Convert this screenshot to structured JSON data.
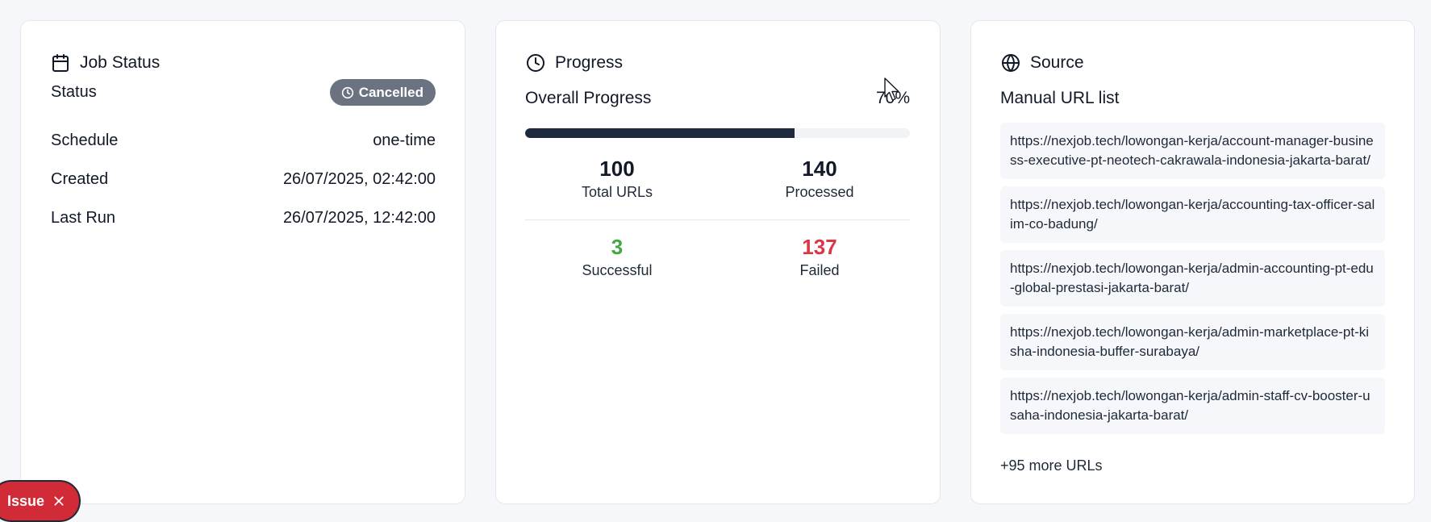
{
  "job_status": {
    "title": "Job Status",
    "status_label": "Status",
    "status_value": "Cancelled",
    "schedule_label": "Schedule",
    "schedule_value": "one-time",
    "created_label": "Created",
    "created_value": "26/07/2025, 02:42:00",
    "last_run_label": "Last Run",
    "last_run_value": "26/07/2025, 12:42:00"
  },
  "progress": {
    "title": "Progress",
    "overall_label": "Overall Progress",
    "overall_value": "70%",
    "overall_fraction": 0.7,
    "total_urls_value": "100",
    "total_urls_label": "Total URLs",
    "processed_value": "140",
    "processed_label": "Processed",
    "successful_value": "3",
    "successful_label": "Successful",
    "failed_value": "137",
    "failed_label": "Failed"
  },
  "source": {
    "title": "Source",
    "list_title": "Manual URL list",
    "urls": [
      "https://nexjob.tech/lowongan-kerja/account-manager-business-executive-pt-neotech-cakrawala-indonesia-jakarta-barat/",
      "https://nexjob.tech/lowongan-kerja/accounting-tax-officer-salim-co-badung/",
      "https://nexjob.tech/lowongan-kerja/admin-accounting-pt-edu-global-prestasi-jakarta-barat/",
      "https://nexjob.tech/lowongan-kerja/admin-marketplace-pt-kisha-indonesia-buffer-surabaya/",
      "https://nexjob.tech/lowongan-kerja/admin-staff-cv-booster-usaha-indonesia-jakarta-barat/"
    ],
    "more_label": "+95 more URLs"
  },
  "issue_pill": {
    "label": "Issue"
  },
  "icons": {
    "job_status": "calendar-icon",
    "progress": "clock-icon",
    "source": "globe-icon",
    "badge": "clock-icon",
    "issue_close": "close-icon"
  },
  "colors": {
    "badge_bg": "#6b7280",
    "progress_fill": "#1e293b",
    "success": "#43a743",
    "failure": "#dc3545",
    "issue_bg": "#d02b36"
  }
}
